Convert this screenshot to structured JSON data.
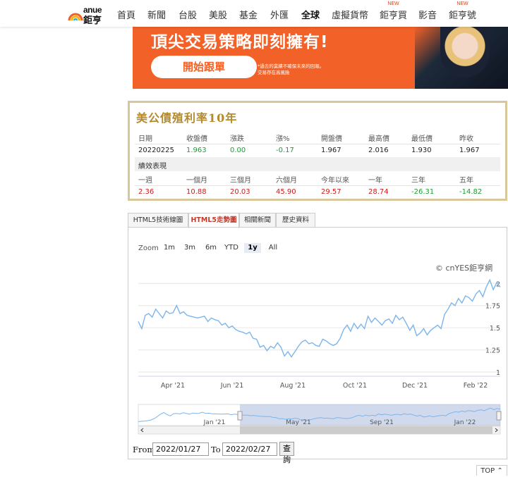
{
  "brand": {
    "logo_top": "anue",
    "logo_bottom": "鉅亨"
  },
  "nav": {
    "items": [
      {
        "label": "首頁",
        "badge": ""
      },
      {
        "label": "新聞",
        "badge": ""
      },
      {
        "label": "台股",
        "badge": ""
      },
      {
        "label": "美股",
        "badge": ""
      },
      {
        "label": "基金",
        "badge": ""
      },
      {
        "label": "外匯",
        "badge": ""
      },
      {
        "label": "全球",
        "badge": ""
      },
      {
        "label": "虛擬貨幣",
        "badge": ""
      },
      {
        "label": "鉅亨買",
        "badge": "NEW"
      },
      {
        "label": "影音",
        "badge": ""
      },
      {
        "label": "鉅亨號",
        "badge": "NEW"
      }
    ],
    "active_index": 6
  },
  "banner": {
    "headline": "頂尖交易策略即刻擁有!",
    "cta": "開始跟單",
    "disclaimer_line1": "*過去的業績不確保未來的回報。",
    "disclaimer_line2": "交易存在高風險"
  },
  "quote": {
    "title": "美公債殖利率10年",
    "headers": [
      "日期",
      "收盤價",
      "漲跌",
      "漲%",
      "開盤價",
      "最高價",
      "最低價",
      "昨收"
    ],
    "values": [
      "20220225",
      "1.963",
      "0.00",
      "-0.17",
      "1.967",
      "2.016",
      "1.930",
      "1.967"
    ],
    "perf_title": "績效表現",
    "perf_headers": [
      "一週",
      "一個月",
      "三個月",
      "六個月",
      "今年以來",
      "一年",
      "三年",
      "五年"
    ],
    "perf_values": [
      "2.36",
      "10.88",
      "20.03",
      "45.90",
      "29.57",
      "28.74",
      "-26.31",
      "-14.82"
    ]
  },
  "tabs": [
    "HTML5技術線圖",
    "HTML5走勢圖",
    "相關新聞",
    "歷史資料"
  ],
  "active_tab": 1,
  "zoom": {
    "label": "Zoom",
    "options": [
      "1m",
      "3m",
      "6m",
      "YTD",
      "1y",
      "All"
    ],
    "selected": "1y"
  },
  "credit": "© cnYES鉅亨網",
  "chart_data": {
    "type": "line",
    "series": [
      {
        "values": [
          1.57,
          1.49,
          1.64,
          1.66,
          1.62,
          1.71,
          1.66,
          1.61,
          1.69,
          1.66,
          1.67,
          1.75,
          1.66,
          1.68,
          1.64,
          1.63,
          1.62,
          1.61,
          1.62,
          1.63,
          1.57,
          1.61,
          1.59,
          1.58,
          1.53,
          1.55,
          1.5,
          1.52,
          1.48,
          1.46,
          1.45,
          1.43,
          1.45,
          1.38,
          1.37,
          1.28,
          1.3,
          1.24,
          1.29,
          1.27,
          1.33,
          1.28,
          1.18,
          1.23,
          1.17,
          1.23,
          1.29,
          1.34,
          1.36,
          1.32,
          1.33,
          1.3,
          1.29,
          1.37,
          1.35,
          1.32,
          1.3,
          1.32,
          1.38,
          1.48,
          1.53,
          1.46,
          1.55,
          1.49,
          1.54,
          1.49,
          1.63,
          1.56,
          1.61,
          1.57,
          1.53,
          1.58,
          1.6,
          1.55,
          1.64,
          1.59,
          1.62,
          1.55,
          1.47,
          1.53,
          1.41,
          1.44,
          1.49,
          1.42,
          1.47,
          1.5,
          1.53,
          1.49,
          1.65,
          1.71,
          1.78,
          1.75,
          1.83,
          1.78,
          1.86,
          1.84,
          1.8,
          1.88,
          1.92,
          1.85,
          1.96,
          2.04,
          1.93,
          2.01,
          1.96
        ]
      }
    ],
    "x_tick_labels": [
      "Apr '21",
      "Jun '21",
      "Aug '21",
      "Oct '21",
      "Dec '21",
      "Feb '22"
    ],
    "y_tick_labels": [
      "1",
      "1.25",
      "1.5",
      "1.75",
      "2"
    ],
    "ylim": [
      1,
      2.05
    ],
    "navigator": {
      "labels": [
        "Jan '21",
        "May '21",
        "Sep '21",
        "Jan '22"
      ]
    }
  },
  "range": {
    "from_label": "From",
    "from_value": "2022/01/27",
    "to_label": "To",
    "to_value": "2022/02/27",
    "submit": "查詢"
  },
  "top_button": "TOP"
}
